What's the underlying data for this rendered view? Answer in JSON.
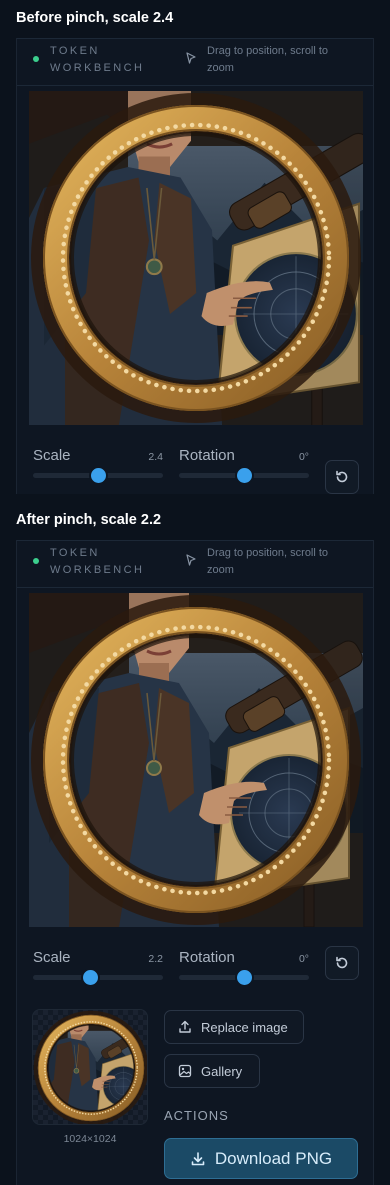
{
  "sections": [
    {
      "title": "Before pinch, scale 2.4",
      "brand": "TOKEN WORKBENCH",
      "hint": "Drag to position, scroll to zoom",
      "scale_label": "Scale",
      "scale_value": "2.4",
      "scale_fraction": 0.5,
      "rotation_label": "Rotation",
      "rotation_value": "0°",
      "rotation_fraction": 0.5
    },
    {
      "title": "After pinch, scale 2.2",
      "brand": "TOKEN WORKBENCH",
      "hint": "Drag to position, scroll to zoom",
      "scale_label": "Scale",
      "scale_value": "2.2",
      "scale_fraction": 0.44,
      "rotation_label": "Rotation",
      "rotation_value": "0°",
      "rotation_fraction": 0.5
    }
  ],
  "sidebar": {
    "thumbnail_dims": "1024×1024",
    "replace_label": "Replace image",
    "gallery_label": "Gallery",
    "actions_heading": "ACTIONS",
    "download_label": "Download PNG"
  },
  "icons": {
    "status": "status-dot",
    "hint": "cursor-arrow-icon",
    "reset": "reset-rotate-icon",
    "replace": "upload-icon",
    "gallery": "image-icon",
    "download": "download-icon"
  },
  "colors": {
    "accent": "#3aa0ec",
    "status": "#3ccf8e",
    "frame_gold": "#c9953c",
    "download_bg": "#1b4a66"
  }
}
